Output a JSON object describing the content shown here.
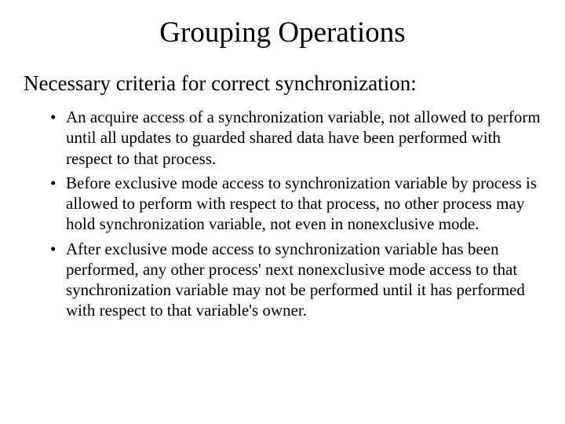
{
  "title": "Grouping Operations",
  "subheading": "Necessary criteria for correct synchronization:",
  "bullets": [
    "An acquire access of a synchronization variable, not allowed to perform until all updates to guarded shared data have been performed with respect to that process.",
    "Before exclusive mode access to synchronization variable by process is allowed to perform with respect to that process, no other process may hold synchronization variable, not even in nonexclusive mode.",
    "After exclusive mode access to synchronization variable has been performed, any other process' next nonexclusive mode access to that synchronization variable may not be performed until it has performed with respect to that variable's owner."
  ]
}
